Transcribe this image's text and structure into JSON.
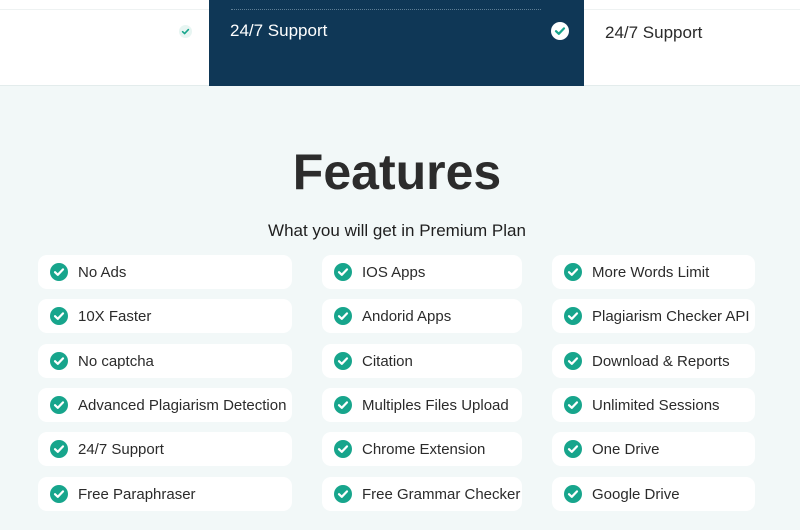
{
  "compare_table": {
    "premium_row_label": "24/7 Support",
    "right_row_label": "24/7 Support"
  },
  "features": {
    "title": "Features",
    "subtitle": "What you will get in Premium Plan",
    "columns": [
      [
        "No Ads",
        "10X Faster",
        "No captcha",
        "Advanced Plagiarism Detection",
        "24/7 Support",
        "Free Paraphraser"
      ],
      [
        "IOS Apps",
        "Andorid Apps",
        "Citation",
        "Multiples Files Upload",
        "Chrome Extension",
        "Free Grammar Checker"
      ],
      [
        "More Words Limit",
        "Plagiarism Checker API",
        "Download & Reports",
        "Unlimited Sessions",
        "One Drive",
        "Google Drive"
      ]
    ]
  },
  "icons": {
    "check": "check-circle-icon"
  },
  "colors": {
    "accent_teal": "#17a58c",
    "premium_navy": "#0f3756",
    "section_bg": "#f2f8f8"
  }
}
